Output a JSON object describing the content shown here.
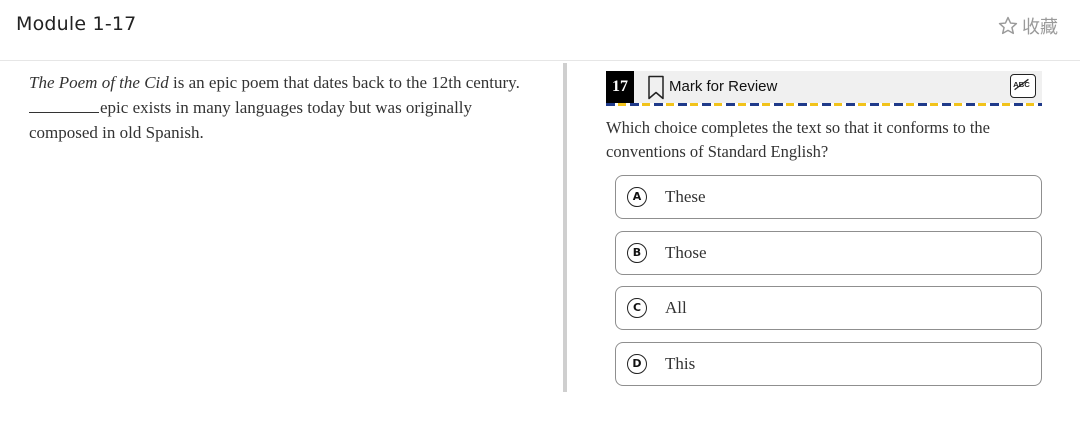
{
  "header": {
    "title": "Module 1-17",
    "collect_label": "收藏",
    "collect_icon": "star-outline-icon"
  },
  "passage": {
    "title_italic": "The Poem of the Cid",
    "line1_rest": " is an epic poem that dates back to the 12th century.",
    "line2_rest": "epic exists in many languages today but was originally",
    "line3": "composed in old Spanish."
  },
  "question_bar": {
    "number": "17",
    "mark_label": "Mark for Review",
    "bookmark_icon": "bookmark-icon",
    "abc_icon": "strikethrough-abc-icon"
  },
  "question": {
    "text": "Which choice completes the text so that it conforms to the conventions of Standard English?"
  },
  "choices": [
    {
      "letter": "A",
      "text": "These"
    },
    {
      "letter": "B",
      "text": "Those"
    },
    {
      "letter": "C",
      "text": "All"
    },
    {
      "letter": "D",
      "text": "This"
    }
  ],
  "colors": {
    "accent_dark": "#1f3a8a",
    "accent_yellow": "#f2c31b",
    "question_number_bg": "#000000"
  }
}
